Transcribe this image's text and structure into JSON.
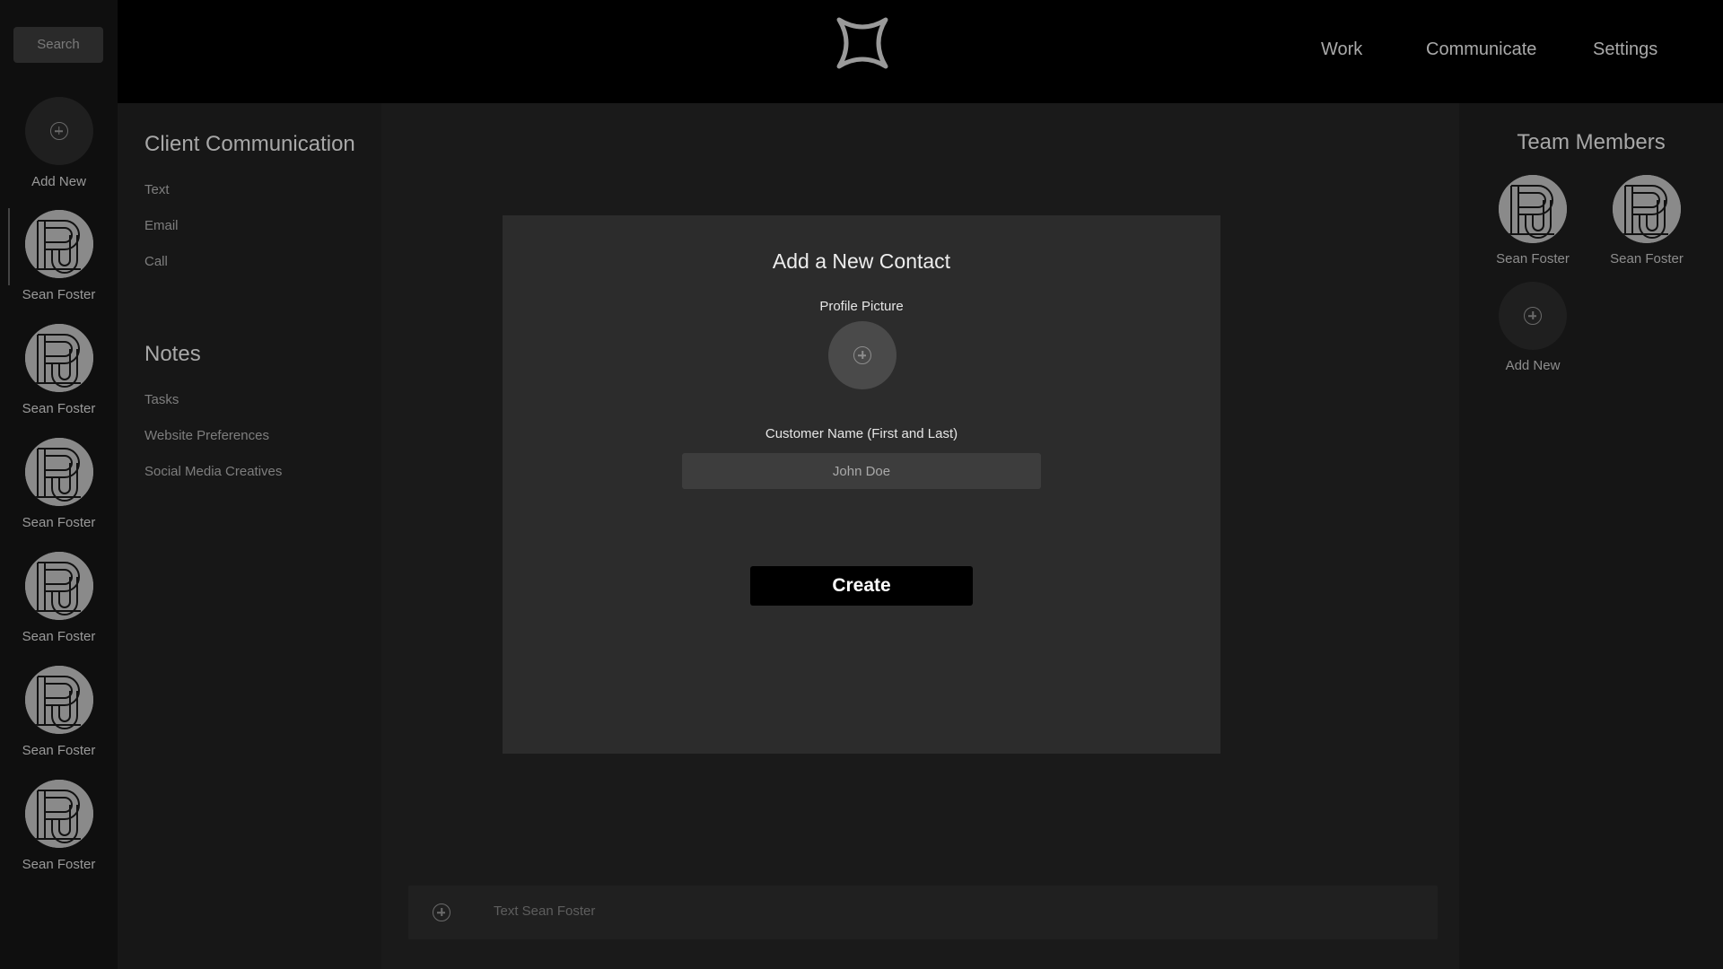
{
  "search": {
    "placeholder": "Search"
  },
  "contacts_rail": {
    "add_new_label": "Add New",
    "contacts": [
      {
        "name": "Sean Foster"
      },
      {
        "name": "Sean Foster"
      },
      {
        "name": "Sean Foster"
      },
      {
        "name": "Sean Foster"
      },
      {
        "name": "Sean Foster"
      },
      {
        "name": "Sean Foster"
      }
    ]
  },
  "header": {
    "nav": [
      "Work",
      "Communicate",
      "Settings"
    ]
  },
  "left_panel": {
    "client_communication": {
      "title": "Client Communication",
      "items": [
        "Text",
        "Email",
        "Call"
      ]
    },
    "notes": {
      "title": "Notes",
      "items": [
        "Tasks",
        "Website Preferences",
        "Social Media Creatives"
      ]
    }
  },
  "modal": {
    "title": "Add a New Contact",
    "profile_picture_label": "Profile Picture",
    "customer_name_label": "Customer Name (First and Last)",
    "customer_name_placeholder": "John Doe",
    "create_label": "Create"
  },
  "composer": {
    "placeholder": "Text Sean Foster"
  },
  "team": {
    "title": "Team Members",
    "members": [
      {
        "name": "Sean Foster"
      },
      {
        "name": "Sean Foster"
      }
    ],
    "add_new_label": "Add New"
  },
  "colors": {
    "background": "#121212",
    "header": "#000000",
    "modal": "#2c2c2c",
    "button": "#000000"
  },
  "icons": [
    "app-logo-icon",
    "add-circle-icon",
    "monogram-avatar-icon"
  ]
}
